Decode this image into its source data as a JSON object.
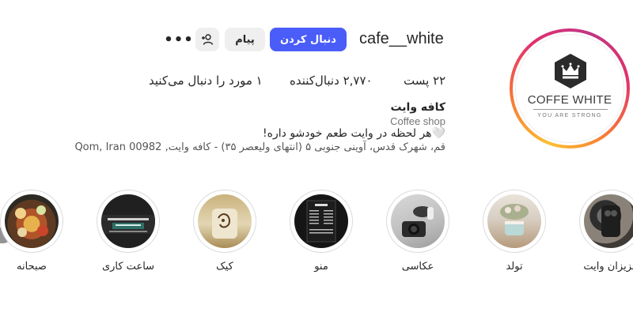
{
  "profile": {
    "username": "cafe__white",
    "logo": {
      "name": "COFFE WHITE",
      "tagline": "YOU ARE STRONG",
      "icon": "crown-hexagon-icon"
    }
  },
  "actions": {
    "follow_label": "دنبال کردن",
    "message_label": "پیام",
    "add_user_icon": "person-plus-icon",
    "more_label": "•••"
  },
  "stats": {
    "posts_count": "۲۲",
    "posts_label": "پست",
    "followers_count": "۲,۷۷۰",
    "followers_label": "دنبال‌کننده",
    "following_count": "۱",
    "following_label": "مورد را دنبال می‌کنید"
  },
  "bio": {
    "name": "کافه وایت",
    "category": "Coffee shop",
    "text": "🤍هر لحظه در وایت طعم خودشو داره!",
    "address": "قم، شهرک قدس، آوینی جنوبی ۵ (انتهای ولیعصر ۳۵) - کافه وایت, Qom, Iran 00982"
  },
  "highlights": [
    {
      "label": "عزیزان وایت"
    },
    {
      "label": "تولد"
    },
    {
      "label": "عکاسی"
    },
    {
      "label": "منو"
    },
    {
      "label": "کیک"
    },
    {
      "label": "ساعت کاری"
    },
    {
      "label": "صبحانه"
    }
  ],
  "colors": {
    "follow_button": "#4a5df9",
    "secondary_button": "#efefef",
    "muted_text": "#737373",
    "story_ring_gradient": [
      "#fdc030",
      "#f77737",
      "#e1306c",
      "#c13584"
    ]
  }
}
